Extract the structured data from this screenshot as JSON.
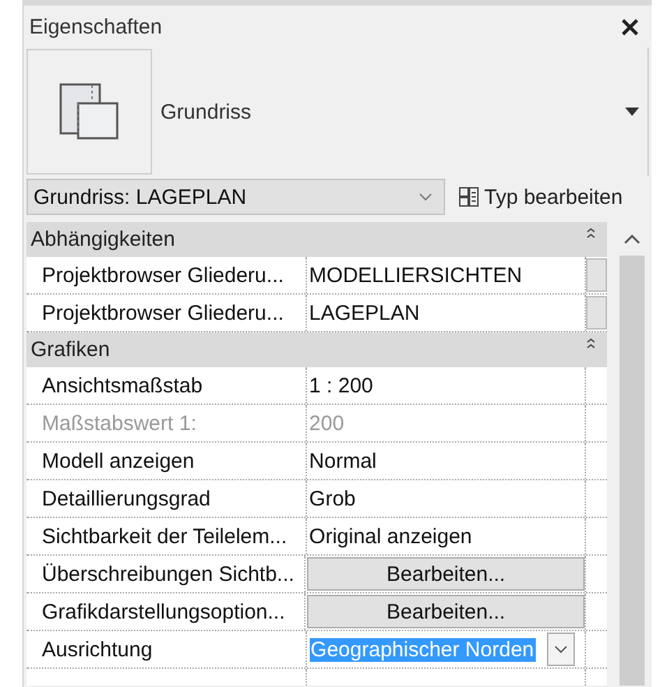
{
  "panel": {
    "title": "Eigenschaften"
  },
  "type_preview": {
    "name": "Grundriss"
  },
  "type_selector": {
    "value": "Grundriss: LAGEPLAN",
    "edit_type": "Typ bearbeiten"
  },
  "groups": [
    {
      "title": "Abhängigkeiten",
      "expanded": true,
      "rows": [
        {
          "label": "Projektbrowser Gliederu...",
          "value": "MODELLIERSICHTEN",
          "kind": "picker",
          "disabled": false
        },
        {
          "label": "Projektbrowser Gliederu...",
          "value": "LAGEPLAN",
          "kind": "picker",
          "disabled": false
        }
      ]
    },
    {
      "title": "Grafiken",
      "expanded": true,
      "rows": [
        {
          "label": "Ansichtsmaßstab",
          "value": " 1 : 200",
          "kind": "text",
          "disabled": false
        },
        {
          "label": "Maßstabswert 1:",
          "value": "200",
          "kind": "text",
          "disabled": true
        },
        {
          "label": "Modell anzeigen",
          "value": "Normal",
          "kind": "text",
          "disabled": false
        },
        {
          "label": "Detaillierungsgrad",
          "value": "Grob",
          "kind": "text",
          "disabled": false
        },
        {
          "label": "Sichtbarkeit der Teilelem...",
          "value": "Original anzeigen",
          "kind": "text",
          "disabled": false
        },
        {
          "label": "Überschreibungen Sichtb...",
          "value": "Bearbeiten...",
          "kind": "button",
          "disabled": false
        },
        {
          "label": "Grafikdarstellungsoption...",
          "value": "Bearbeiten...",
          "kind": "button",
          "disabled": false
        },
        {
          "label": "Ausrichtung",
          "value": "Geographischer Norden",
          "kind": "dropdown",
          "disabled": false
        }
      ]
    }
  ]
}
